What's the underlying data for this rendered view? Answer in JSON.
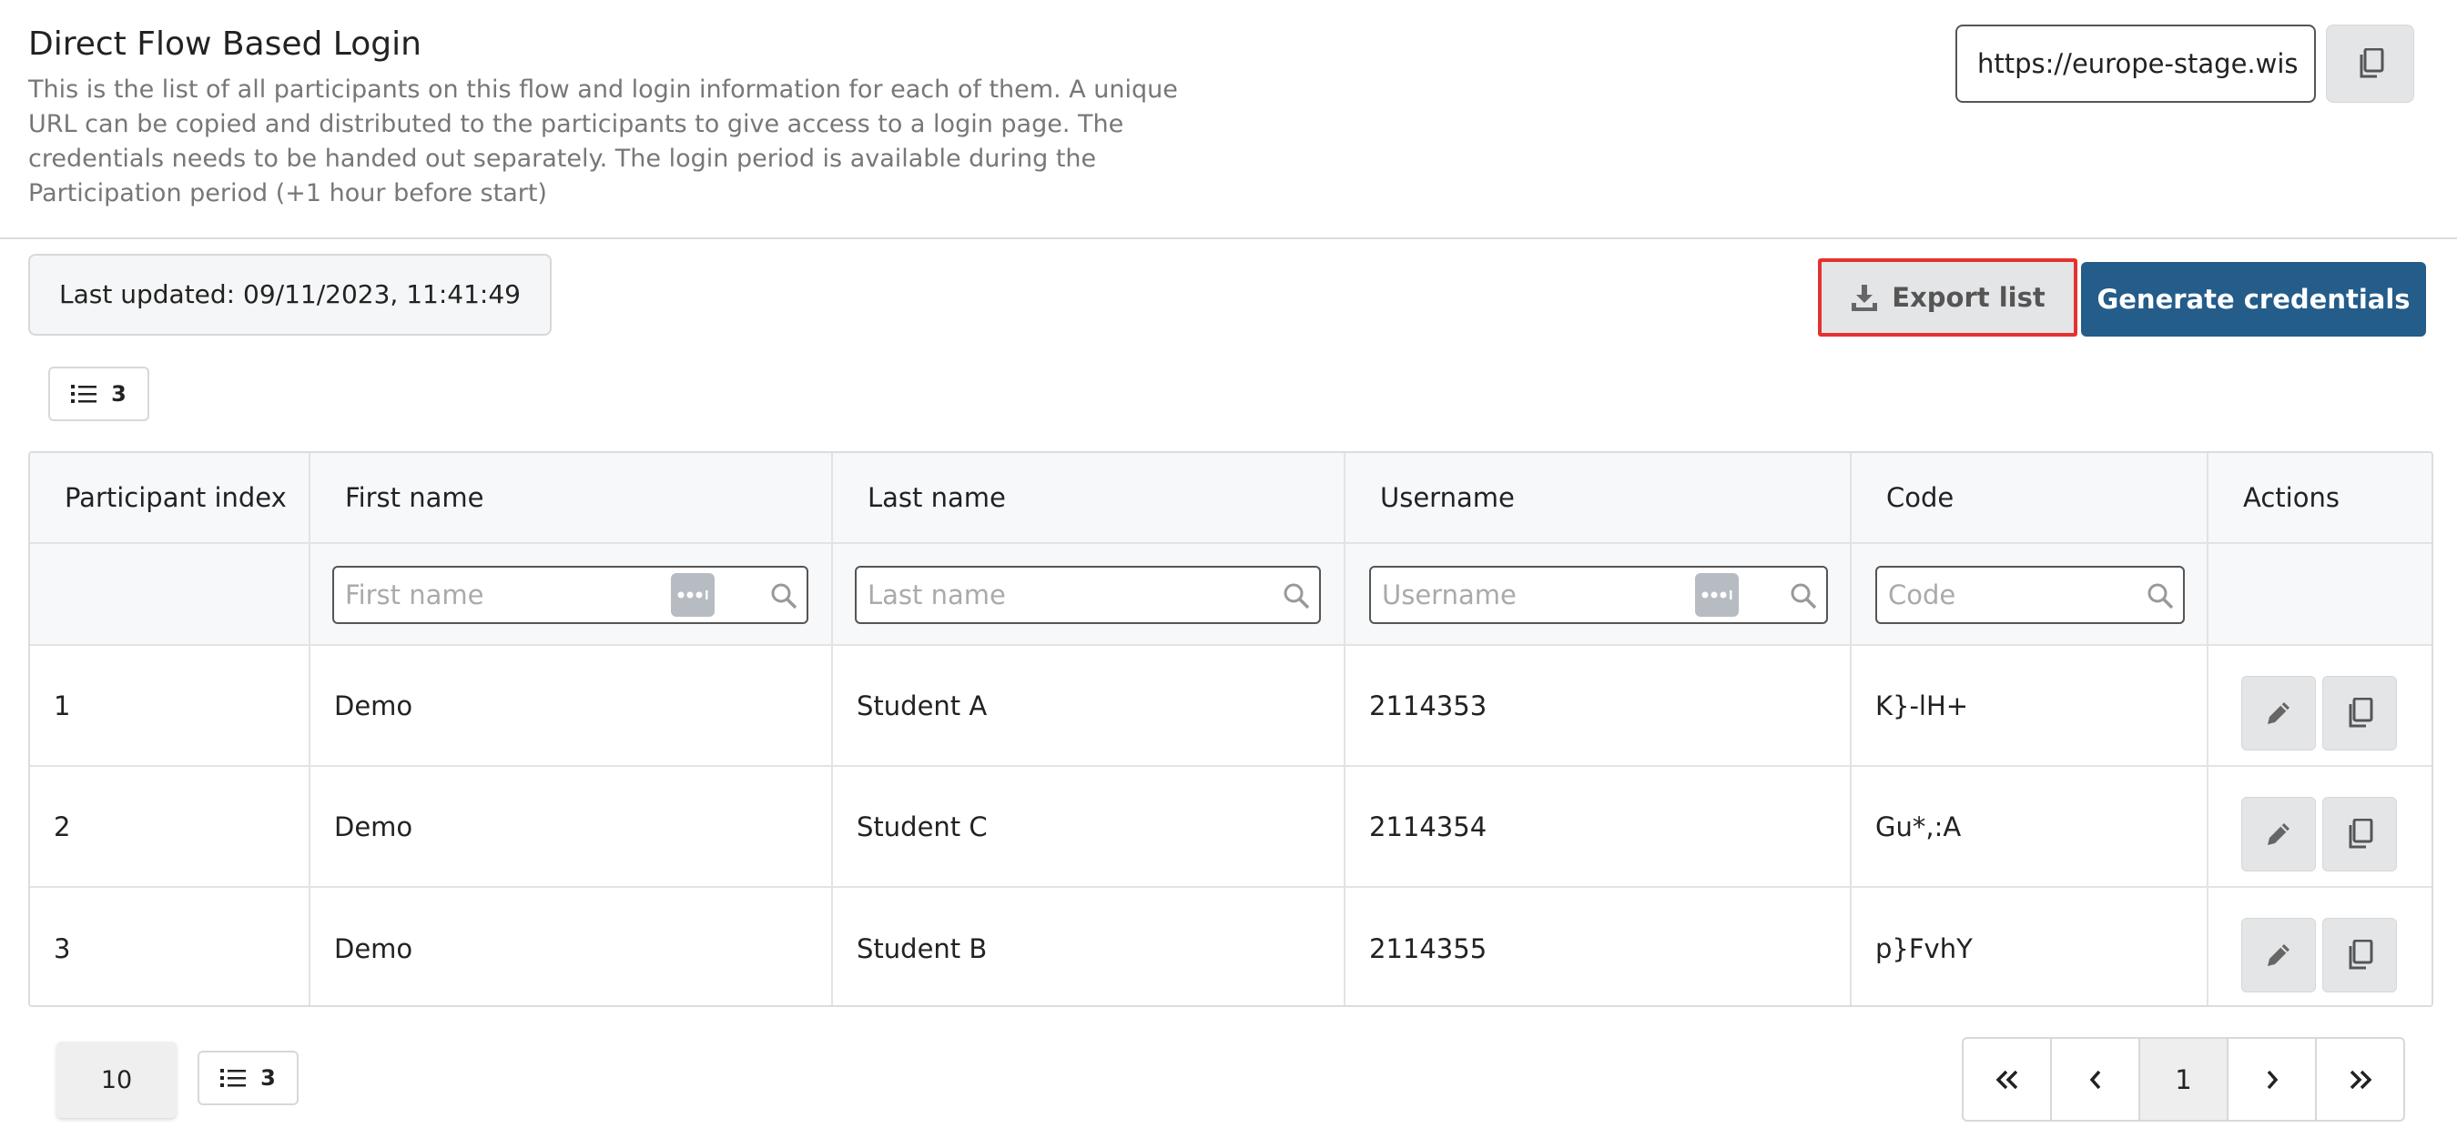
{
  "header": {
    "title": "Direct Flow Based Login",
    "description": "This is the list of all participants on this flow and login information for each of them. A unique URL can be copied and distributed to the participants to give access to a login page. The credentials needs to be handed out separately. The login period is available during the Participation period (+1 hour before start)",
    "url_value": "https://europe-stage.wis"
  },
  "toolbar": {
    "last_updated": "Last updated: 09/11/2023, 11:41:49",
    "export_label": "Export list",
    "generate_label": "Generate credentials",
    "column_count": "3"
  },
  "table": {
    "columns": [
      "Participant index",
      "First name",
      "Last name",
      "Username",
      "Code",
      "Actions"
    ],
    "filters": {
      "first_name": "First name",
      "last_name": "Last name",
      "username": "Username",
      "code": "Code"
    },
    "rows": [
      {
        "index": "1",
        "first": "Demo",
        "last": "Student A",
        "username": "2114353",
        "code": "K}-lH+"
      },
      {
        "index": "2",
        "first": "Demo",
        "last": "Student C",
        "username": "2114354",
        "code": "Gu*,:A"
      },
      {
        "index": "3",
        "first": "Demo",
        "last": "Student B",
        "username": "2114355",
        "code": "p}FvhY"
      }
    ]
  },
  "footer": {
    "page_size": "10",
    "column_count": "3",
    "current_page": "1"
  },
  "icons": {
    "copy": "copy-icon",
    "download": "download-icon",
    "list": "list-icon",
    "search": "search-icon",
    "password_dots": "password-dots-icon",
    "edit": "pencil-icon"
  },
  "colors": {
    "primary": "#245c8a",
    "highlight_border": "#e5312f",
    "button_grey": "#e4e5e7"
  }
}
